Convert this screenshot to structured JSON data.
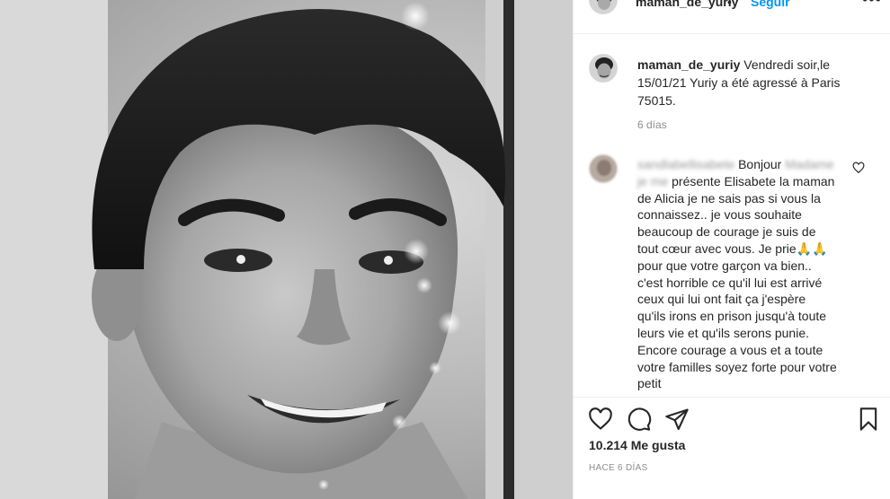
{
  "post": {
    "username": "maman_de_yuriy",
    "follow_label": "Seguir",
    "separator": "•",
    "more_label": "•••"
  },
  "caption": {
    "username": "maman_de_yuriy",
    "text": "Vendredi soir,le 15/01/21 Yuriy a été agressé à Paris 75015.",
    "time": "6 días"
  },
  "comment": {
    "username_blurred": "sandlabellisabete",
    "first_line": "Bonjour",
    "second_line_blurred": "Madame je me",
    "body": "présente Elisabete la maman de Alicia je ne sais pas si vous la connaissez.. je vous souhaite beaucoup de courage je suis de tout cœur avec vous. Je prie🙏🙏 pour que votre garçon va bien.. c'est horrible ce qu'il lui est arrivé ceux qui lui ont fait ça j'espère qu'ils irons en prison jusqu'à toute leurs vie et qu'ils serons punie. Encore courage a vous et a toute votre familles soyez forte pour votre petit"
  },
  "stats": {
    "likes": "10.214 Me gusta",
    "posted_ago": "HACE 6 DÍAS"
  },
  "icons": {
    "like": "heart-icon",
    "comment": "comment-bubble-icon",
    "share": "paper-plane-icon",
    "save": "bookmark-icon",
    "comment_like": "small-heart-icon"
  },
  "colors": {
    "accent": "#0095f6",
    "text": "#262626",
    "secondary": "#8e8e8e",
    "border": "#efefef"
  }
}
